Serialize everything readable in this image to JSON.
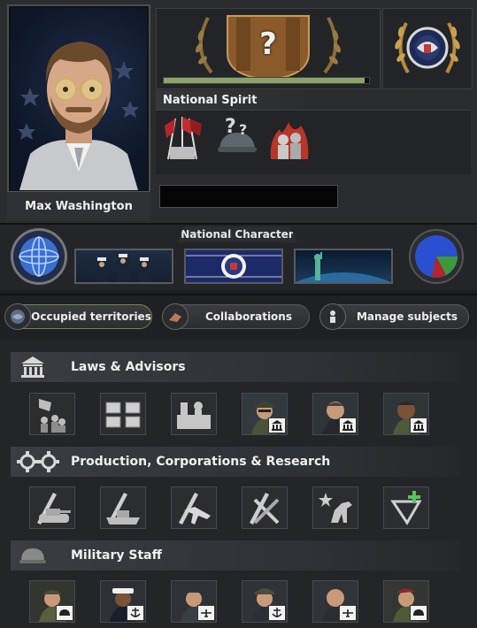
{
  "leader": {
    "name": "Max Washington"
  },
  "party": {
    "icon": "question-mark-party-icon",
    "popularity": 0.98
  },
  "seal": {
    "icon": "us-presidential-seal-icon"
  },
  "national_spirit": {
    "header": "National Spirit",
    "items": [
      {
        "icon": "flags-spirit-icon"
      },
      {
        "icon": "helmet-question-spirit-icon"
      },
      {
        "icon": "burning-soldiers-spirit-icon"
      }
    ]
  },
  "national_character": {
    "header": "National Character",
    "items": [
      {
        "icon": "globe-icon"
      },
      {
        "icon": "naval-officers-portrait"
      },
      {
        "icon": "presidential-seal-flag"
      },
      {
        "icon": "statue-of-liberty-globe"
      },
      {
        "icon": "ideology-pie-chart"
      }
    ]
  },
  "tabs": [
    {
      "label": "Occupied territories",
      "icon": "occupied-territories-icon",
      "active": true
    },
    {
      "label": "Collaborations",
      "icon": "collaborations-icon",
      "active": false
    },
    {
      "label": "Manage subjects",
      "icon": "manage-subjects-icon",
      "active": false
    }
  ],
  "sections": {
    "laws": {
      "title": "Laws & Advisors",
      "icon": "government-building-icon",
      "slots": [
        {
          "icon": "flags-crowd-law-icon"
        },
        {
          "icon": "crates-law-icon"
        },
        {
          "icon": "factory-workers-law-icon"
        },
        {
          "icon": "advisor-general-icon",
          "badge": "building"
        },
        {
          "icon": "advisor-politician-icon",
          "badge": "building"
        },
        {
          "icon": "advisor-soldier-icon",
          "badge": "building"
        }
      ]
    },
    "production": {
      "title": "Production, Corporations & Research",
      "icon": "gears-icon",
      "slots": [
        {
          "icon": "tank-research-icon"
        },
        {
          "icon": "naval-research-icon"
        },
        {
          "icon": "aircraft-research-icon"
        },
        {
          "icon": "weapons-research-icon"
        },
        {
          "icon": "star-horse-icon"
        },
        {
          "icon": "add-research-icon"
        }
      ]
    },
    "military": {
      "title": "Military Staff",
      "icon": "helmet-icon",
      "slots": [
        {
          "icon": "army-chief-icon",
          "badge": "helmet"
        },
        {
          "icon": "navy-chief-icon",
          "badge": "anchor"
        },
        {
          "icon": "air-chief-icon",
          "badge": "plane"
        },
        {
          "icon": "navy-officer-icon",
          "badge": "anchor"
        },
        {
          "icon": "air-officer-icon",
          "badge": "plane"
        },
        {
          "icon": "army-officer-icon",
          "badge": "helmet"
        }
      ]
    }
  },
  "colors": {
    "background": "#1b1d20",
    "accent_green": "#8aa36a",
    "gold": "#b58a3c"
  }
}
